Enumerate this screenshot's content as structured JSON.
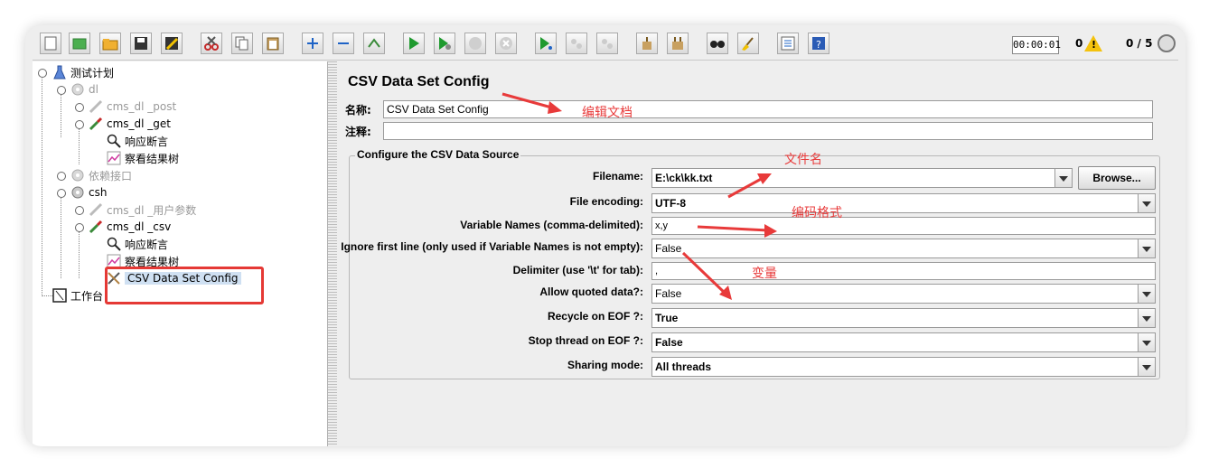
{
  "toolbar": {
    "elapsed_time": "00:00:01",
    "error_count": "0",
    "warning_mark": "!",
    "thread_count": "0 / 5"
  },
  "tree": {
    "items": [
      {
        "label": "测试计划"
      },
      {
        "label": "dl"
      },
      {
        "label": "cms_dl _post"
      },
      {
        "label": "cms_dl _get"
      },
      {
        "label": "响应断言"
      },
      {
        "label": "察看结果树"
      },
      {
        "label": "依赖接口"
      },
      {
        "label": "csh"
      },
      {
        "label": "cms_dl _用户参数"
      },
      {
        "label": "cms_dl _csv"
      },
      {
        "label": "响应断言"
      },
      {
        "label": "察看结果树"
      },
      {
        "label": "CSV Data Set Config"
      },
      {
        "label": "工作台"
      }
    ]
  },
  "panel": {
    "title": "CSV Data Set Config",
    "name_label": "名称:",
    "name_value": "CSV Data Set Config",
    "comment_label": "注释:",
    "comment_value": "",
    "group_title": "Configure the CSV Data Source",
    "fields": [
      {
        "label": "Filename:",
        "value": "E:\\ck\\kk.txt"
      },
      {
        "label": "File encoding:",
        "value": "UTF-8"
      },
      {
        "label": "Variable Names (comma-delimited):",
        "value": "x,y"
      },
      {
        "label": "Ignore first line (only used if Variable Names is not empty):",
        "value": "False"
      },
      {
        "label": "Delimiter (use '\\t' for tab):",
        "value": ","
      },
      {
        "label": "Allow quoted data?:",
        "value": "False"
      },
      {
        "label": "Recycle on EOF ?:",
        "value": "True"
      },
      {
        "label": "Stop thread on EOF ?:",
        "value": "False"
      },
      {
        "label": "Sharing mode:",
        "value": "All threads"
      }
    ],
    "browse_label": "Browse..."
  },
  "annotations": {
    "edit_doc": "编辑文档",
    "file_name": "文件名",
    "encoding": "编码格式",
    "variables": "变量"
  },
  "colors": {
    "annotation": "#e83a3a",
    "selection": "#cfe0f2",
    "panel_bg": "#eeeeee"
  }
}
